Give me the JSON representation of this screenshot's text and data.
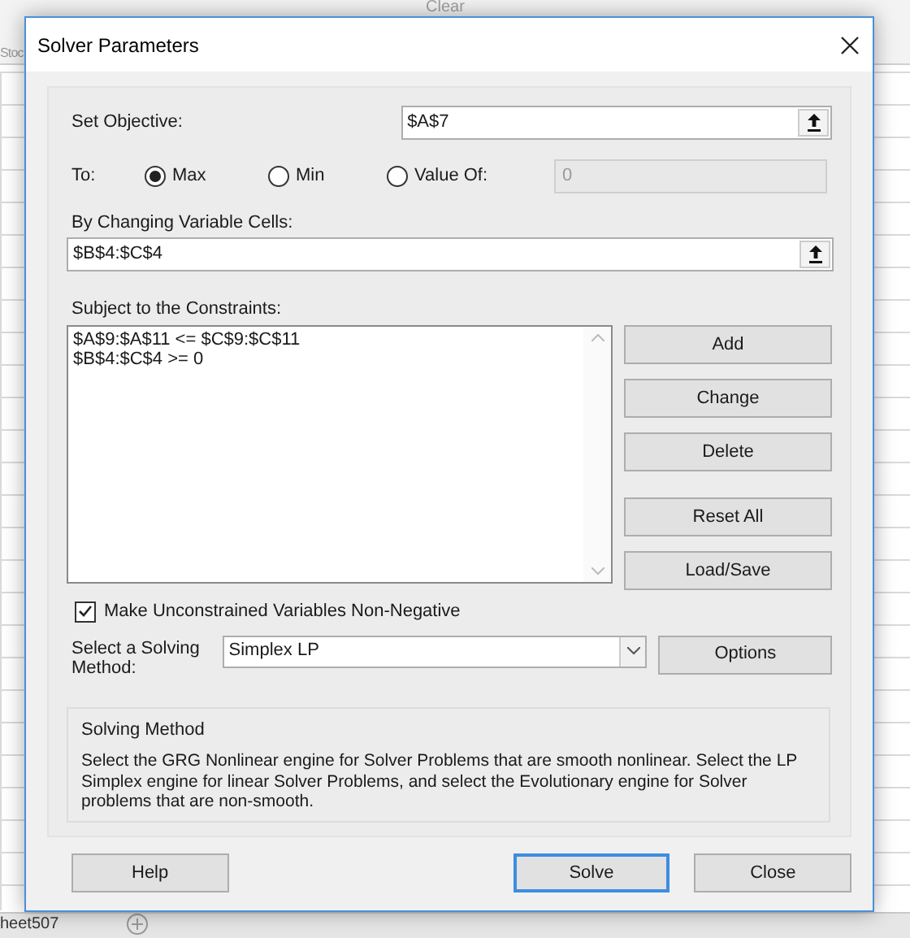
{
  "background": {
    "ribbon_labels": [
      "Stoc",
      "Clear"
    ],
    "sheet_tab": "heet507"
  },
  "dialog": {
    "title": "Solver Parameters",
    "objective": {
      "label": "Set Objective:",
      "value": "$A$7"
    },
    "to": {
      "label": "To:",
      "options": [
        {
          "label": "Max",
          "selected": true
        },
        {
          "label": "Min",
          "selected": false
        },
        {
          "label": "Value Of:",
          "selected": false
        }
      ],
      "value_field": {
        "value": "0",
        "disabled": true
      }
    },
    "changing_cells": {
      "label": "By Changing Variable Cells:",
      "value": "$B$4:$C$4"
    },
    "constraints": {
      "label": "Subject to the Constraints:",
      "items": [
        "$A$9:$A$11 <= $C$9:$C$11",
        "$B$4:$C$4 >= 0"
      ]
    },
    "side_buttons": [
      "Add",
      "Change",
      "Delete",
      "Reset All",
      "Load/Save"
    ],
    "non_negative": {
      "label": "Make Unconstrained Variables Non-Negative",
      "checked": true
    },
    "method": {
      "label": "Select a Solving Method:",
      "value": "Simplex LP"
    },
    "options_button": "Options",
    "description": {
      "title": "Solving Method",
      "text": "Select the GRG Nonlinear engine for Solver Problems that are smooth nonlinear. Select the LP Simplex engine for linear Solver Problems, and select the Evolutionary engine for Solver problems that are non-smooth."
    },
    "footer_buttons": [
      {
        "label": "Help",
        "default": false
      },
      {
        "label": "Solve",
        "default": true
      },
      {
        "label": "Close",
        "default": false
      }
    ]
  }
}
